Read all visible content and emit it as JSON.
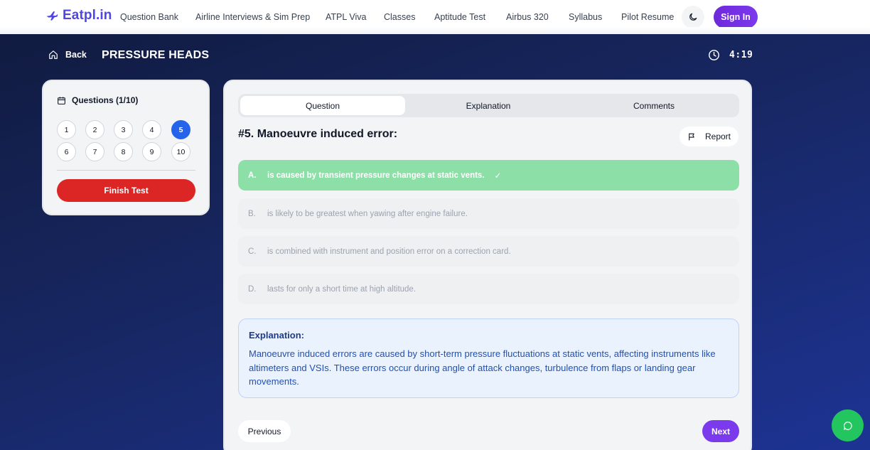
{
  "navbar": {
    "logo_text": "Eatpl.in",
    "links": [
      "Question Bank",
      "Airline Interviews & Sim Prep",
      "ATPL Viva",
      "Classes",
      "Aptitude Test",
      "Airbus 320",
      "Syllabus",
      "Pilot Resume"
    ],
    "signin_label": "Sign In",
    "theme_icon": "moon-icon"
  },
  "header": {
    "back_label": "Back",
    "title": "PRESSURE HEADS",
    "timer": "4:19"
  },
  "sidebar": {
    "heading": "Questions (1/10)",
    "questions": [
      "1",
      "2",
      "3",
      "4",
      "5",
      "6",
      "7",
      "8",
      "9",
      "10"
    ],
    "active_question": "5",
    "finish_label": "Finish Test"
  },
  "main": {
    "tabs": [
      "Question",
      "Explanation",
      "Comments"
    ],
    "active_tab": "Question",
    "question_title": "#5. Manoeuvre induced error:",
    "report_label": "Report",
    "options": [
      {
        "letter": "A.",
        "text": "is caused by transient pressure changes at static vents.",
        "correct": true
      },
      {
        "letter": "B.",
        "text": "is likely to be greatest when yawing after engine failure.",
        "correct": false
      },
      {
        "letter": "C.",
        "text": "is combined with instrument and position error on a correction card.",
        "correct": false
      },
      {
        "letter": "D.",
        "text": "lasts for only a short time at high altitude.",
        "correct": false
      }
    ],
    "check_mark": "✓",
    "explanation_title": "Explanation:",
    "explanation_body": "Manoeuvre induced errors are caused by short-term pressure fluctuations at static vents, affecting instruments like altimeters and VSIs. These errors occur during angle of attack changes, turbulence from flaps or landing gear movements.",
    "previous_label": "Previous",
    "next_label": "Next"
  },
  "colors": {
    "brand": "#4f46e5",
    "active_question": "#2563eb",
    "finish": "#dc2626",
    "correct": "#8ddfa8",
    "next": "#7c3aed",
    "chat": "#22c55e"
  }
}
